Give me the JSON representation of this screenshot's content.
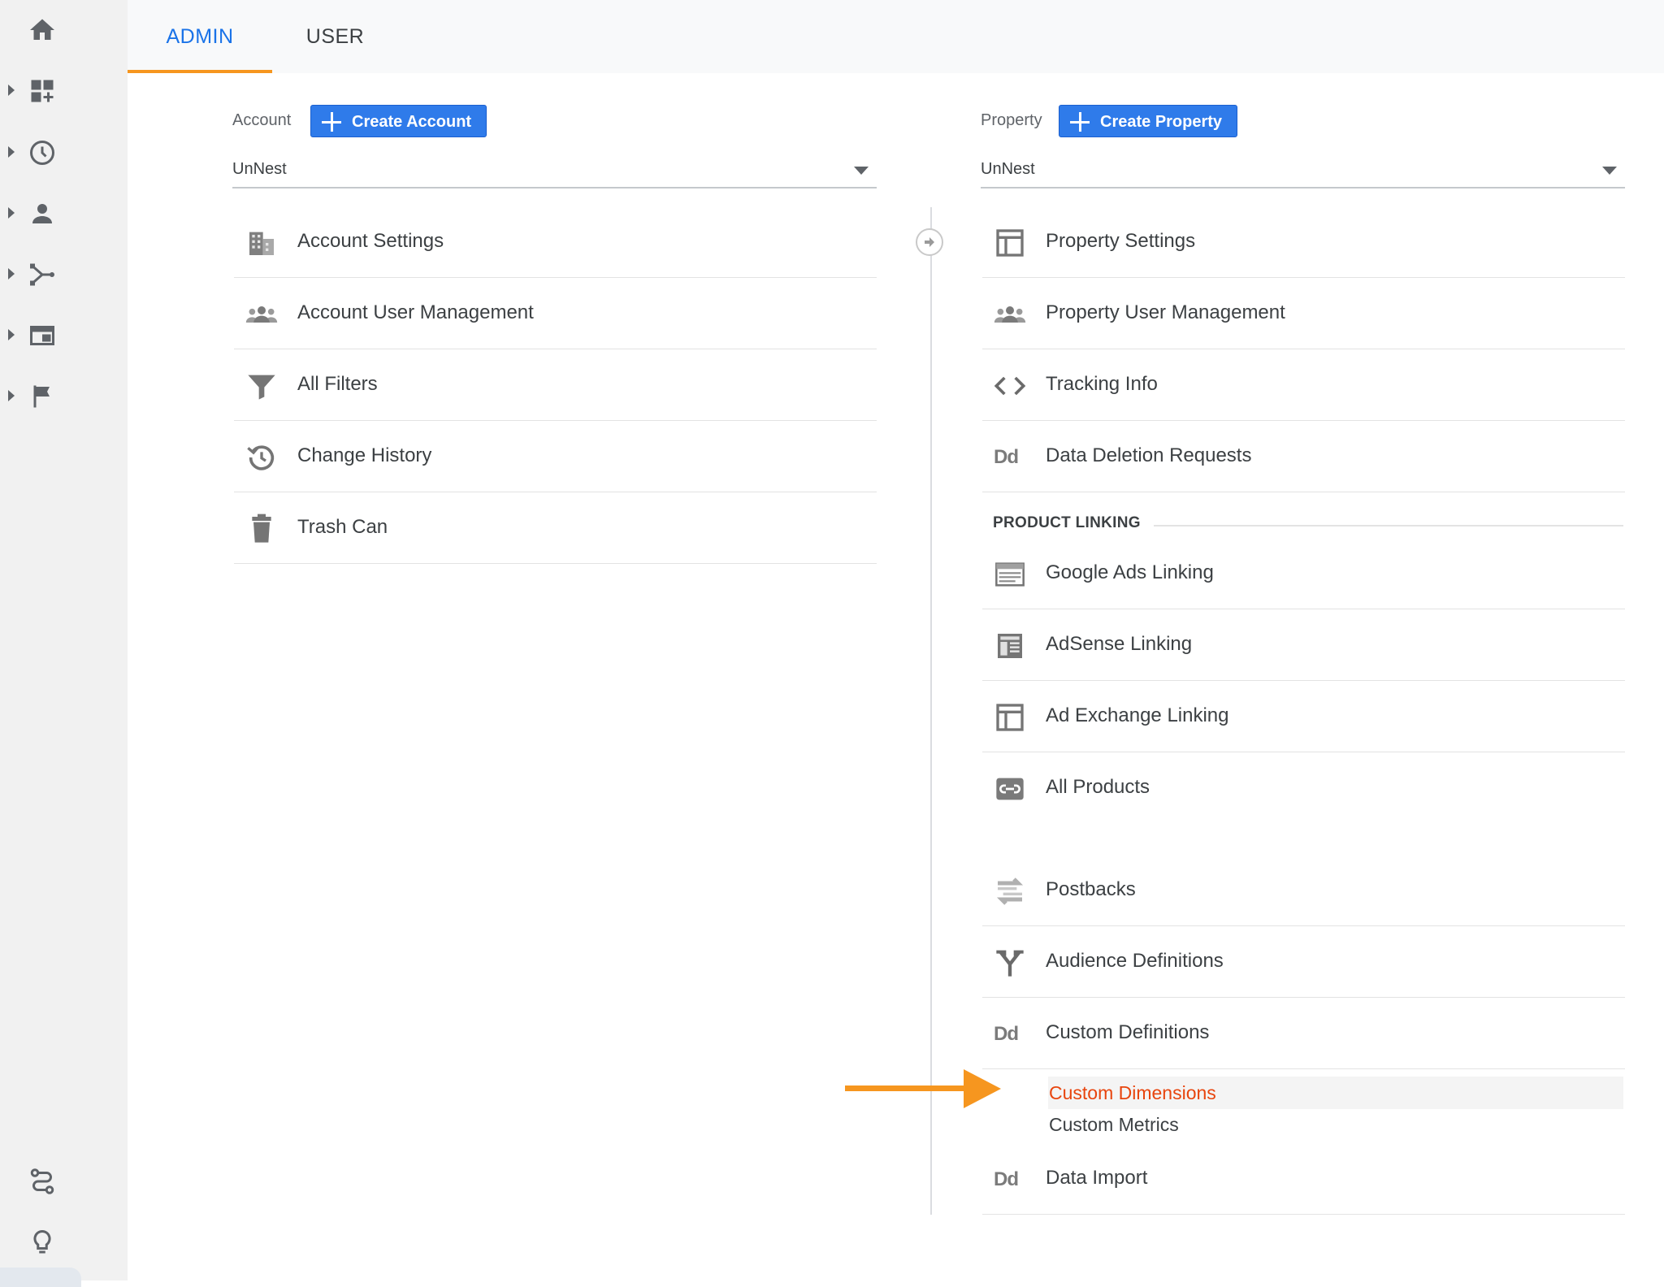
{
  "tabs": [
    {
      "label": "ADMIN",
      "active": true
    },
    {
      "label": "USER",
      "active": false
    }
  ],
  "sidebar": {
    "icons": [
      "home-icon",
      "dashboard-add-icon",
      "clock-icon",
      "person-icon",
      "acquisition-icon",
      "behavior-icon",
      "flag-icon",
      "route-icon",
      "lightbulb-icon"
    ]
  },
  "account": {
    "label": "Account",
    "create_label": "Create Account",
    "selected": "UnNest",
    "items": [
      {
        "label": "Account Settings",
        "icon": "building-icon"
      },
      {
        "label": "Account User Management",
        "icon": "users-icon"
      },
      {
        "label": "All Filters",
        "icon": "filter-icon"
      },
      {
        "label": "Change History",
        "icon": "history-icon"
      },
      {
        "label": "Trash Can",
        "icon": "trash-icon"
      }
    ]
  },
  "property": {
    "label": "Property",
    "create_label": "Create Property",
    "selected": "UnNest",
    "items": [
      {
        "label": "Property Settings",
        "icon": "window-icon"
      },
      {
        "label": "Property User Management",
        "icon": "users-icon"
      },
      {
        "label": "Tracking Info",
        "icon": "code-icon"
      },
      {
        "label": "Data Deletion Requests",
        "icon": "Dd"
      }
    ],
    "product_linking_header": "PRODUCT LINKING",
    "linking_items": [
      {
        "label": "Google Ads Linking",
        "icon": "ads-icon"
      },
      {
        "label": "AdSense Linking",
        "icon": "adsense-icon"
      },
      {
        "label": "Ad Exchange Linking",
        "icon": "window-icon"
      },
      {
        "label": "All Products",
        "icon": "link-icon"
      },
      {
        "label": "Postbacks",
        "icon": "postbacks-icon"
      },
      {
        "label": "Audience Definitions",
        "icon": "audience-icon"
      },
      {
        "label": "Custom Definitions",
        "icon": "Dd"
      }
    ],
    "custom_sub_items": [
      {
        "label": "Custom Dimensions",
        "active": true
      },
      {
        "label": "Custom Metrics",
        "active": false
      }
    ],
    "last_item": {
      "label": "Data Import",
      "icon": "Dd"
    }
  },
  "colors": {
    "active_tab": "#1a73e8",
    "tab_underline": "#f6961f",
    "button_blue": "#2f7bea",
    "active_sub_item": "#e8450e",
    "arrow": "#f6961f"
  }
}
